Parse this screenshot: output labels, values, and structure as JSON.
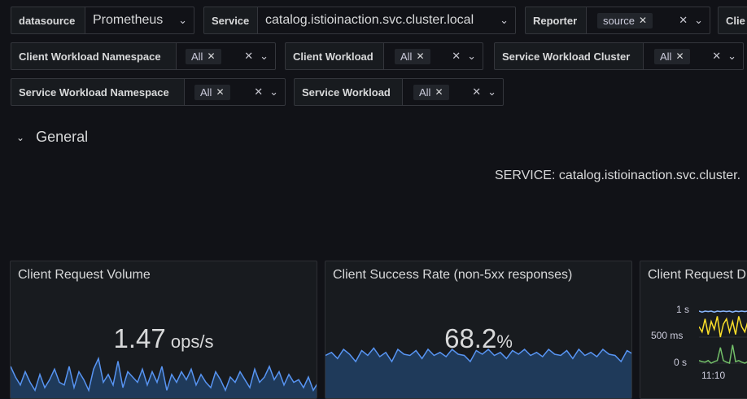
{
  "variables": {
    "datasource": {
      "label": "datasource",
      "value": "Prometheus"
    },
    "service": {
      "label": "Service",
      "value": "catalog.istioinaction.svc.cluster.local"
    },
    "reporter": {
      "label": "Reporter",
      "chip": "source"
    },
    "client_trunc": {
      "label": "Clie"
    },
    "client_workload_namespace": {
      "label": "Client Workload Namespace",
      "chip": "All"
    },
    "client_workload": {
      "label": "Client Workload",
      "chip": "All"
    },
    "service_workload_cluster": {
      "label": "Service Workload Cluster",
      "chip": "All"
    },
    "service_workload_namespace": {
      "label": "Service Workload Namespace",
      "chip": "All"
    },
    "service_workload": {
      "label": "Service Workload",
      "chip": "All"
    }
  },
  "icons": {
    "close": "×",
    "chevron": "⌄",
    "remove": "✕"
  },
  "row": {
    "title": "General",
    "icon": "chevron-down-icon"
  },
  "service_banner": "SERVICE: catalog.istioinaction.svc.cluster.",
  "panels": {
    "client_request_volume": {
      "title": "Client Request Volume",
      "value": "1.47",
      "unit": " ops/s"
    },
    "client_success_rate": {
      "title": "Client Success Rate (non-5xx responses)",
      "value": "68.2",
      "unit": "%"
    },
    "client_request_duration": {
      "title": "Client Request D",
      "y_ticks": [
        "1 s",
        "500 ms",
        "0 s"
      ],
      "x_tick": "11:10"
    }
  },
  "colors": {
    "accent_blue": "#5794f2",
    "fill_blue": "#1f3a5a",
    "yellow": "#fade2a",
    "green": "#73bf69"
  },
  "chart_data": [
    {
      "type": "area",
      "title": "Client Request Volume",
      "values": [
        0.6,
        0.4,
        0.25,
        0.5,
        0.3,
        0.15,
        0.45,
        0.2,
        0.35,
        0.55,
        0.3,
        0.25,
        0.6,
        0.2,
        0.5,
        0.35,
        0.15,
        0.55,
        0.75,
        0.3,
        0.45,
        0.25,
        0.7,
        0.2,
        0.5,
        0.4,
        0.3,
        0.55,
        0.25,
        0.5,
        0.3,
        0.6,
        0.15,
        0.45,
        0.3,
        0.5,
        0.35,
        0.55,
        0.25,
        0.45,
        0.3,
        0.2,
        0.5,
        0.35,
        0.15,
        0.4,
        0.3,
        0.5,
        0.35,
        0.2,
        0.55,
        0.3,
        0.4,
        0.6,
        0.35,
        0.5,
        0.25,
        0.45,
        0.3,
        0.35,
        0.2,
        0.4,
        0.15,
        0.3
      ]
    },
    {
      "type": "area",
      "title": "Client Success Rate (non-5xx responses)",
      "values": [
        0.7,
        0.75,
        0.65,
        0.8,
        0.72,
        0.6,
        0.78,
        0.7,
        0.82,
        0.68,
        0.75,
        0.6,
        0.8,
        0.72,
        0.7,
        0.78,
        0.65,
        0.8,
        0.7,
        0.75,
        0.68,
        0.8,
        0.72,
        0.7,
        0.6,
        0.78,
        0.72,
        0.8,
        0.7,
        0.75,
        0.65,
        0.78,
        0.72,
        0.8,
        0.7,
        0.75,
        0.68,
        0.8,
        0.72,
        0.7,
        0.78,
        0.65,
        0.8,
        0.7,
        0.75,
        0.68,
        0.8,
        0.72,
        0.7,
        0.6,
        0.78,
        0.72
      ]
    },
    {
      "type": "line",
      "title": "Client Request D",
      "y_ticks": [
        "1 s",
        "500 ms",
        "0 s"
      ],
      "x": [
        "11:10"
      ],
      "series": [
        {
          "values": [
            1.0,
            0.98,
            1.0,
            0.99,
            1.0,
            0.98,
            1.0,
            0.99,
            1.0,
            0.99,
            1.0,
            0.98,
            1.0,
            0.99,
            1.0,
            0.99,
            1.0
          ]
        },
        {
          "values": [
            0.7,
            0.6,
            0.85,
            0.55,
            0.8,
            0.65,
            0.9,
            0.5,
            0.75,
            0.85,
            0.6,
            0.8,
            0.55,
            0.9,
            0.7,
            0.6,
            0.8
          ]
        },
        {
          "values": [
            0.05,
            0.03,
            0.02,
            0.05,
            0.0,
            0.03,
            0.05,
            0.3,
            0.05,
            0.02,
            0.0,
            0.35,
            0.03,
            0.05,
            0.02,
            0.0,
            0.03
          ]
        }
      ]
    }
  ]
}
